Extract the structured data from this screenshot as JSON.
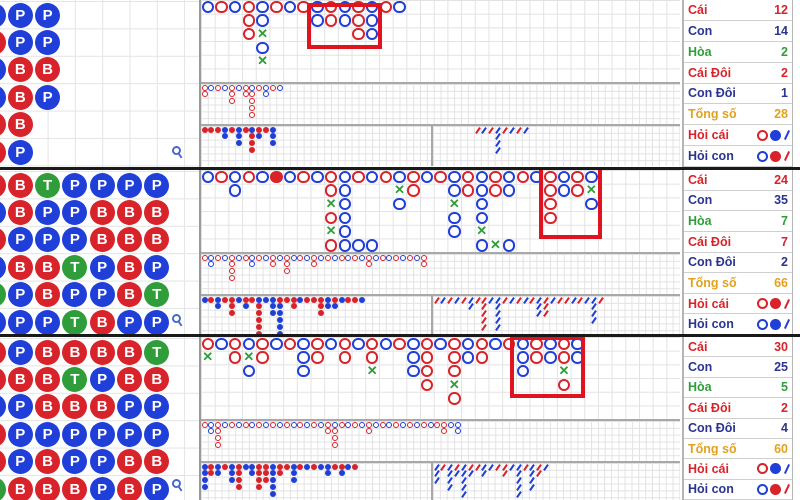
{
  "colors": {
    "banker": "#d8232a",
    "player": "#1f3fd8",
    "tie": "#2f9e3a",
    "total": "#e2a21e",
    "navy": "#2b3590"
  },
  "sections": [
    {
      "bead_plate": [
        "PBPPBB",
        "PPBBBP",
        "PPBP"
      ],
      "big_road": [
        "B",
        "R",
        "B",
        "RRR",
        "BBXBX",
        "R",
        "B",
        "R",
        "BB",
        "RR",
        "BB",
        "RRR",
        "BBB",
        "R",
        "B"
      ],
      "big_eye_road": [
        "RR",
        "B",
        "R",
        "B",
        "RRR",
        "B",
        "RR",
        "BRRRR",
        "R",
        "BB",
        "R",
        "B"
      ],
      "small_road": [
        "R",
        "R",
        "R",
        "BB",
        "R",
        "BBB",
        "R",
        "BRRR",
        "RB",
        "R",
        "BBB"
      ],
      "cockroach_road": [
        "..",
        "..",
        "..",
        "..",
        "..",
        "..",
        "R",
        "B",
        "R",
        "BBBB",
        "R",
        "B",
        "R",
        "B"
      ],
      "stats": [
        {
          "label": "Cái",
          "value": "12"
        },
        {
          "label": "Con",
          "value": "14"
        },
        {
          "label": "Hòa",
          "value": "2"
        },
        {
          "label": "Cái Đôi",
          "value": "2"
        },
        {
          "label": "Con Đôi",
          "value": "1"
        },
        {
          "label": "Tổng số",
          "value": "28"
        }
      ],
      "ask_banker": {
        "label": "Hỏi cái",
        "icons": "RBB"
      },
      "ask_player": {
        "label": "Hỏi con",
        "icons": "BRR"
      }
    },
    {
      "bead_plate": [
        "BPBPTP",
        "BBPBPP",
        "TPPBBP",
        "PPPTPT",
        "PBBPPB",
        "PBBBBP",
        "PBBPTP"
      ],
      "big_road": [
        "B",
        "R",
        "BB",
        "R",
        "B",
        "F",
        "B",
        "R",
        "B",
        "RRXRXR",
        "BBBBBB",
        "R....B",
        "B....B",
        "R",
        "BXB",
        "RR",
        "B",
        "R",
        "BBXBB",
        "RR",
        "BBBBXB",
        "RR...X",
        "BB...B",
        "R",
        "B",
        "RRRR",
        "BB",
        "RR",
        "BXB"
      ],
      "big_eye_road": [
        "R",
        "BB",
        "R",
        "B",
        "RRRR",
        "B",
        "R",
        "BB",
        "R",
        "B",
        "RR",
        "B",
        "RRR",
        "B",
        "R",
        "B",
        "RR",
        "B",
        "R",
        "B",
        "R",
        "B",
        "R",
        "B",
        "RR",
        "B",
        "R",
        "B",
        "R",
        "B",
        "R",
        "B",
        "RR"
      ],
      "small_road": [
        "B",
        "R",
        "BB",
        "R",
        "RRR",
        "B",
        "RB",
        "R",
        "BRRRRR",
        "B",
        "BBB",
        "RBBBBB",
        "R",
        "RR",
        "B",
        "R",
        "R",
        "RRR",
        "BB",
        "RB",
        "B",
        "R",
        "R",
        "B"
      ],
      "cockroach_road": [
        "R",
        "B",
        "R",
        "B",
        "R",
        "BB",
        "R",
        "RRRRR",
        "B",
        "BBBBB",
        "R",
        "B",
        "R",
        "B",
        "R",
        "BBB",
        "RRR",
        "B",
        "R",
        "R",
        "B",
        "R",
        "B",
        "BBBB",
        "R"
      ],
      "stats": [
        {
          "label": "Cái",
          "value": "24"
        },
        {
          "label": "Con",
          "value": "35"
        },
        {
          "label": "Hòa",
          "value": "7"
        },
        {
          "label": "Cái Đôi",
          "value": "7"
        },
        {
          "label": "Con Đôi",
          "value": "2"
        },
        {
          "label": "Tổng số",
          "value": "66"
        }
      ],
      "ask_banker": {
        "label": "Hỏi cái",
        "icons": "RRR"
      },
      "ask_player": {
        "label": "Hỏi con",
        "icons": "BBB"
      }
    },
    {
      "bead_plate": [
        "BBPBBT",
        "PBPPPB",
        "BBBPBB",
        "BTBPPB",
        "BPBPPP",
        "BBPPBB",
        "TBPPBP"
      ],
      "big_road": [
        "RX",
        "B",
        "RR",
        "BXB",
        "RR",
        "B",
        "R",
        "BBB",
        "RR",
        "B",
        "RR",
        "B",
        "RRX",
        "B",
        "R",
        "BBB",
        "RRRR",
        "B",
        "RRRXR",
        "BB",
        "RR",
        "B",
        "R",
        "BBB",
        "RR",
        "BB",
        "RRXR",
        "BB"
      ],
      "big_eye_road": [
        "R",
        "BB",
        "RRRR",
        "B",
        "R",
        "B",
        "R",
        "B",
        "R",
        "B",
        "R",
        "B",
        "R",
        "B",
        "R",
        "B",
        "R",
        "B",
        "RR",
        "BRRR",
        "R",
        "B",
        "R",
        "B",
        "RR",
        "B",
        "R",
        "B",
        "R",
        "B",
        "R",
        "B",
        "R",
        "B",
        "R",
        "RR",
        "B",
        "BB"
      ],
      "small_road": [
        "BBBB",
        "RR",
        "BB",
        "R",
        "BBB",
        "RRRR",
        "B",
        "BB",
        "RRRR",
        "RRR",
        "BBBBB",
        "RR",
        "R",
        "BBB",
        "R",
        "B",
        "R",
        "B",
        "BB",
        "R",
        "RB",
        "B",
        "R"
      ],
      "cockroach_road": [
        "BBB",
        "R",
        "BBBB",
        "RB",
        "BBBBB",
        "RB",
        "R",
        "BB",
        "B",
        "R",
        "RR",
        "B",
        "BBBBB",
        "R",
        "BBBB",
        "RR",
        "B"
      ],
      "stats": [
        {
          "label": "Cái",
          "value": "30"
        },
        {
          "label": "Con",
          "value": "25"
        },
        {
          "label": "Hòa",
          "value": "5"
        },
        {
          "label": "Cái Đôi",
          "value": "2"
        },
        {
          "label": "Con Đôi",
          "value": "4"
        },
        {
          "label": "Tổng số",
          "value": "60"
        }
      ],
      "ask_banker": {
        "label": "Hỏi cái",
        "icons": "RBB"
      },
      "ask_player": {
        "label": "Hỏi con",
        "icons": "BRR"
      }
    }
  ]
}
